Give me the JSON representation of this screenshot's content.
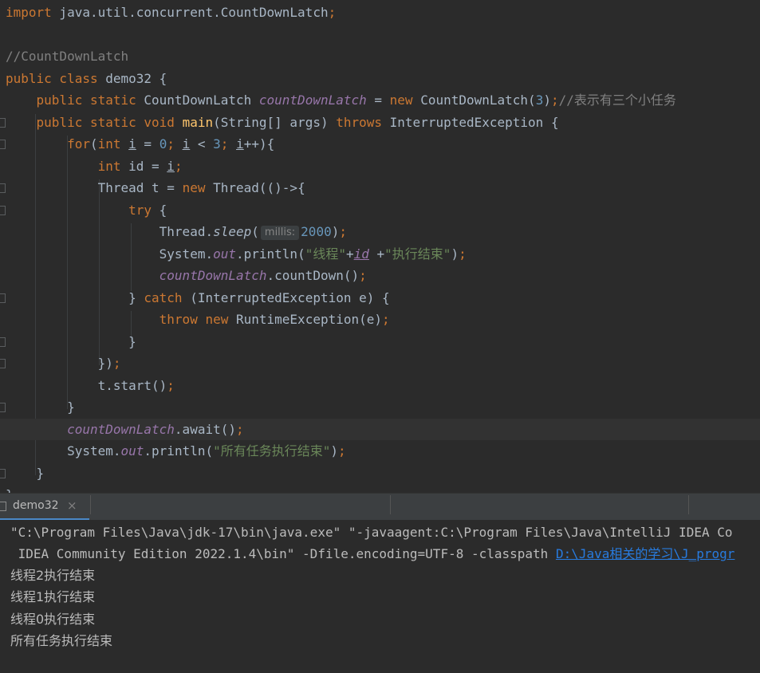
{
  "editor": {
    "lines": [
      [
        {
          "t": "import",
          "c": "kw"
        },
        {
          "t": " java.util.concurrent.CountDownLatch"
        },
        {
          "t": ";",
          "c": "kw"
        }
      ],
      [],
      [
        {
          "t": "//CountDownLatch",
          "c": "cmt"
        }
      ],
      [
        {
          "t": "public class",
          "c": "kw"
        },
        {
          "t": " demo32 {"
        }
      ],
      [
        {
          "t": "    "
        },
        {
          "t": "public static",
          "c": "kw"
        },
        {
          "t": " CountDownLatch "
        },
        {
          "t": "countDownLatch",
          "c": "fld"
        },
        {
          "t": " = "
        },
        {
          "t": "new",
          "c": "kw"
        },
        {
          "t": " CountDownLatch("
        },
        {
          "t": "3",
          "c": "num"
        },
        {
          "t": ")"
        },
        {
          "t": ";",
          "c": "kw"
        },
        {
          "t": "//表示有三个小任务",
          "c": "cmt"
        }
      ],
      [
        {
          "t": "    "
        },
        {
          "t": "public static void",
          "c": "kw"
        },
        {
          "t": " "
        },
        {
          "t": "main",
          "c": "fn"
        },
        {
          "t": "(String[] args) "
        },
        {
          "t": "throws",
          "c": "kw"
        },
        {
          "t": " InterruptedException {"
        }
      ],
      [
        {
          "t": "        "
        },
        {
          "t": "for",
          "c": "kw"
        },
        {
          "t": "("
        },
        {
          "t": "int",
          "c": "kw"
        },
        {
          "t": " "
        },
        {
          "t": "i",
          "c": "ul"
        },
        {
          "t": " = "
        },
        {
          "t": "0",
          "c": "num"
        },
        {
          "t": "; ",
          "c": "kw"
        },
        {
          "t": "i",
          "c": "ul"
        },
        {
          "t": " < "
        },
        {
          "t": "3",
          "c": "num"
        },
        {
          "t": "; ",
          "c": "kw"
        },
        {
          "t": "i",
          "c": "ul"
        },
        {
          "t": "++){"
        }
      ],
      [
        {
          "t": "            "
        },
        {
          "t": "int",
          "c": "kw"
        },
        {
          "t": " id = "
        },
        {
          "t": "i",
          "c": "ul"
        },
        {
          "t": ";",
          "c": "kw"
        }
      ],
      [
        {
          "t": "            Thread t = "
        },
        {
          "t": "new",
          "c": "kw"
        },
        {
          "t": " Thread(()->{"
        }
      ],
      [
        {
          "t": "                "
        },
        {
          "t": "try",
          "c": "kw"
        },
        {
          "t": " {"
        }
      ],
      [
        {
          "t": "                    Thread."
        },
        {
          "t": "sleep",
          "c": "it"
        },
        {
          "t": "("
        },
        {
          "t": "millis:",
          "c": "hint"
        },
        {
          "t": "2000",
          "c": "num"
        },
        {
          "t": ")"
        },
        {
          "t": ";",
          "c": "kw"
        }
      ],
      [
        {
          "t": "                    System."
        },
        {
          "t": "out",
          "c": "fld"
        },
        {
          "t": ".println("
        },
        {
          "t": "\"线程\"",
          "c": "str"
        },
        {
          "t": "+"
        },
        {
          "t": "id",
          "c": "fld ul"
        },
        {
          "t": " +"
        },
        {
          "t": "\"执行结束\"",
          "c": "str"
        },
        {
          "t": ")"
        },
        {
          "t": ";",
          "c": "kw"
        }
      ],
      [
        {
          "t": "                    "
        },
        {
          "t": "countDownLatch",
          "c": "fld"
        },
        {
          "t": ".countDown()"
        },
        {
          "t": ";",
          "c": "kw"
        }
      ],
      [
        {
          "t": "                } "
        },
        {
          "t": "catch",
          "c": "kw"
        },
        {
          "t": " (InterruptedException e) {"
        }
      ],
      [
        {
          "t": "                    "
        },
        {
          "t": "throw new",
          "c": "kw"
        },
        {
          "t": " RuntimeException(e)"
        },
        {
          "t": ";",
          "c": "kw"
        }
      ],
      [
        {
          "t": "                }"
        }
      ],
      [
        {
          "t": "            })"
        },
        {
          "t": ";",
          "c": "kw"
        }
      ],
      [
        {
          "t": "            t.start()"
        },
        {
          "t": ";",
          "c": "kw"
        }
      ],
      [
        {
          "t": "        }"
        }
      ],
      [
        {
          "t": "        "
        },
        {
          "t": "countDownLatch",
          "c": "fld"
        },
        {
          "t": ".await()"
        },
        {
          "t": ";",
          "c": "kw"
        }
      ],
      [
        {
          "t": "        System."
        },
        {
          "t": "out",
          "c": "fld"
        },
        {
          "t": ".println("
        },
        {
          "t": "\"所有任务执行结束\"",
          "c": "str"
        },
        {
          "t": ")"
        },
        {
          "t": ";",
          "c": "kw"
        }
      ],
      [
        {
          "t": "    }"
        }
      ],
      [
        {
          "t": "}"
        }
      ]
    ]
  },
  "console": {
    "tab_label": "demo32",
    "close_glyph": "×",
    "cmd_line1": "\"C:\\Program Files\\Java\\jdk-17\\bin\\java.exe\" \"-javaagent:C:\\Program Files\\Java\\IntelliJ IDEA Co",
    "cmd_line2": " IDEA Community Edition 2022.1.4\\bin\" -Dfile.encoding=UTF-8 -classpath ",
    "classpath_link": "D:\\Java相关的学习\\J_progr",
    "output": [
      "线程2执行结束",
      "线程1执行结束",
      "线程0执行结束",
      "所有任务执行结束"
    ]
  }
}
